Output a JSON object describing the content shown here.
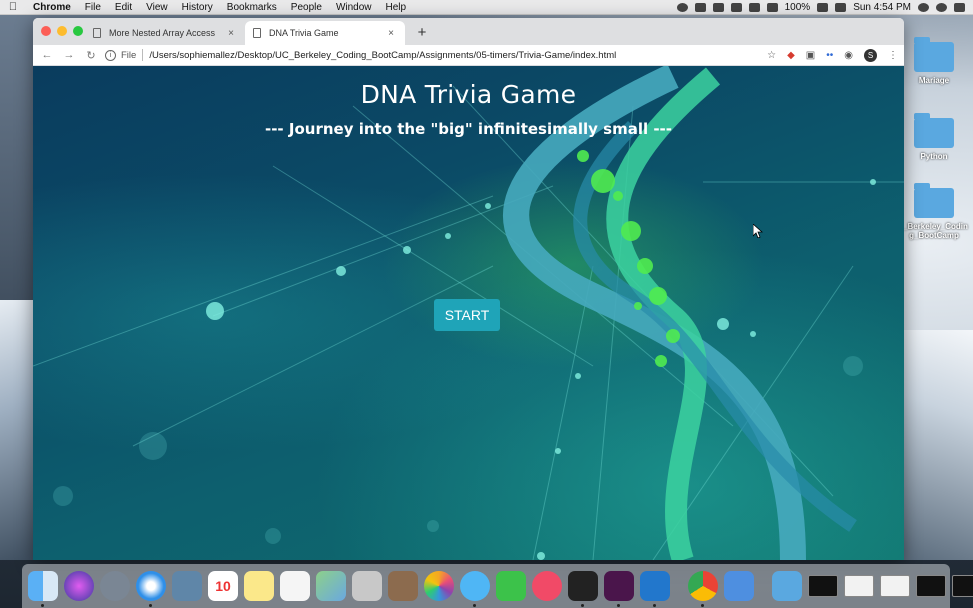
{
  "menubar": {
    "app_name": "Chrome",
    "items": [
      "File",
      "Edit",
      "View",
      "History",
      "Bookmarks",
      "People",
      "Window",
      "Help"
    ],
    "battery": "100%",
    "clock": "Sun 4:54 PM"
  },
  "browser": {
    "tabs": [
      {
        "label": "More Nested Array Access",
        "active": false
      },
      {
        "label": "DNA Trivia Game",
        "active": true
      }
    ],
    "new_tab_glyph": "+",
    "close_glyph": "×",
    "address": {
      "scheme_label": "File",
      "url": "/Users/sophiemallez/Desktop/UC_Berkeley_Coding_BootCamp/Assignments/05-timers/Trivia-Game/index.html"
    },
    "profile_initial": "S"
  },
  "page": {
    "title": "DNA Trivia Game",
    "subtitle": "--- Journey into the \"big\" infinitesimally small ---",
    "start_button": "START",
    "colors": {
      "button": "#1fa4b8",
      "accent_green": "#46e05a",
      "bg_deep": "#0a3c5e"
    }
  },
  "desktop": {
    "icons": [
      {
        "label": "Mariage",
        "icon": "folder-icon"
      },
      {
        "label": "Python",
        "icon": "folder-icon"
      },
      {
        "label": "_Berkeley_Codin g_BootCamp",
        "icon": "folder-icon"
      }
    ]
  },
  "dock": {
    "calendar_day": "10",
    "apps": [
      "finder",
      "siri",
      "launchpad",
      "safari",
      "mail-stamp",
      "calendar",
      "notes",
      "reminders",
      "maps",
      "photos-booth",
      "books",
      "photos",
      "messages",
      "facetime",
      "music",
      "terminal",
      "slack",
      "vscode",
      "chrome",
      "xcode",
      "downloads-folder"
    ]
  }
}
